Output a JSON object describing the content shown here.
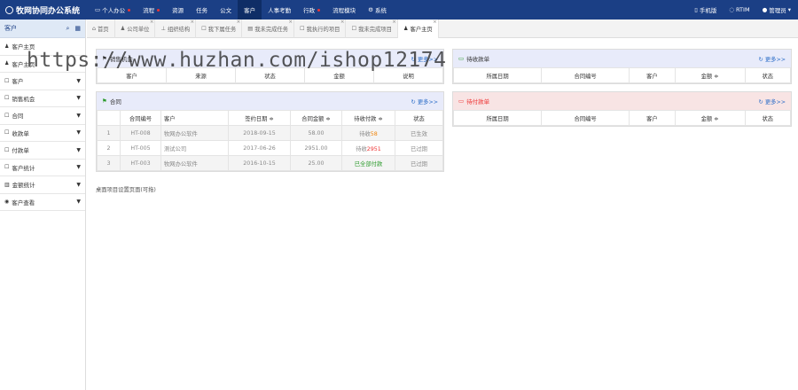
{
  "app": {
    "title": "牧网协同办公系统"
  },
  "nav": {
    "items": [
      {
        "label": "个人办公",
        "badge": true
      },
      {
        "label": "流程",
        "badge": true
      },
      {
        "label": "资源",
        "badge": false
      },
      {
        "label": "任务",
        "badge": false
      },
      {
        "label": "公文",
        "badge": false
      },
      {
        "label": "客户",
        "badge": false
      },
      {
        "label": "人事考勤",
        "badge": false
      },
      {
        "label": "行政",
        "badge": true
      },
      {
        "label": "流程模块",
        "badge": false
      },
      {
        "label": "系统",
        "badge": false
      }
    ],
    "right": {
      "mobile": "手机版",
      "rtim": "RTIM",
      "user": "管理员"
    }
  },
  "sidebar": {
    "header": "客户",
    "items": [
      {
        "label": "客户主页",
        "icon": "user-icon",
        "arrow": false
      },
      {
        "label": "客户主页",
        "icon": "user-icon",
        "arrow": false
      },
      {
        "label": "客户",
        "icon": "list-icon",
        "arrow": true
      },
      {
        "label": "销售机会",
        "icon": "list-icon",
        "arrow": true
      },
      {
        "label": "合同",
        "icon": "list-icon",
        "arrow": true
      },
      {
        "label": "收款单",
        "icon": "list-icon",
        "arrow": true
      },
      {
        "label": "付款单",
        "icon": "list-icon",
        "arrow": true
      },
      {
        "label": "客户统计",
        "icon": "list-icon",
        "arrow": true
      },
      {
        "label": "金额统计",
        "icon": "chart-icon",
        "arrow": true
      },
      {
        "label": "客户查看",
        "icon": "eye-icon",
        "arrow": true
      }
    ]
  },
  "tabs": [
    {
      "label": "首页",
      "closable": false,
      "active": false
    },
    {
      "label": "公司单位",
      "closable": true,
      "active": false
    },
    {
      "label": "组织结构",
      "closable": true,
      "active": false
    },
    {
      "label": "我下属任务",
      "closable": true,
      "active": false
    },
    {
      "label": "我未完成任务",
      "closable": true,
      "active": false
    },
    {
      "label": "我执行的项目",
      "closable": true,
      "active": false
    },
    {
      "label": "我未完成项目",
      "closable": true,
      "active": false
    },
    {
      "label": "客户主页",
      "closable": true,
      "active": true
    }
  ],
  "panel_opportunities": {
    "title": "销售机会",
    "more": "更多>>",
    "columns": [
      "客户",
      "来源",
      "状态",
      "金额",
      "说明"
    ]
  },
  "panel_contracts": {
    "title": "合同",
    "more": "更多>>",
    "columns": [
      "",
      "合同编号",
      "客户",
      "签约日期 ≑",
      "合同金额 ≑",
      "待收付款 ≑",
      "状态"
    ],
    "rows": [
      {
        "no": "1",
        "code": "HT-008",
        "client": "牧网办公软件",
        "date": "2018-09-15",
        "amount": "58.00",
        "pending_prefix": "待收",
        "pending_value": "58",
        "pending_color": "orange",
        "status": "已生效"
      },
      {
        "no": "2",
        "code": "HT-005",
        "client": "测试公司",
        "date": "2017-06-26",
        "amount": "2951.00",
        "pending_prefix": "待收",
        "pending_value": "2951",
        "pending_color": "red",
        "status": "已过期"
      },
      {
        "no": "3",
        "code": "HT-003",
        "client": "牧网办公软件",
        "date": "2016-10-15",
        "amount": "25.00",
        "pending_prefix": "",
        "pending_value": "已全部付款",
        "pending_color": "green",
        "status": "已过期"
      }
    ]
  },
  "panel_receivable": {
    "title": "待收款单",
    "more": "更多>>",
    "columns": [
      "所属日期",
      "合同编号",
      "客户",
      "金额 ≑",
      "状态"
    ]
  },
  "panel_payable": {
    "title": "待付款单",
    "more": "更多>>",
    "columns": [
      "所属日期",
      "合同编号",
      "客户",
      "金额 ≑",
      "状态"
    ]
  },
  "note": "桌面项目设置页面(可拖)",
  "watermark": "https://www.huzhan.com/ishop12174",
  "colors": {
    "topbar": "#1b3f85",
    "link": "#2a6cc7",
    "orange": "#f0840a",
    "red": "#e33333",
    "green": "#2a9a2a"
  }
}
